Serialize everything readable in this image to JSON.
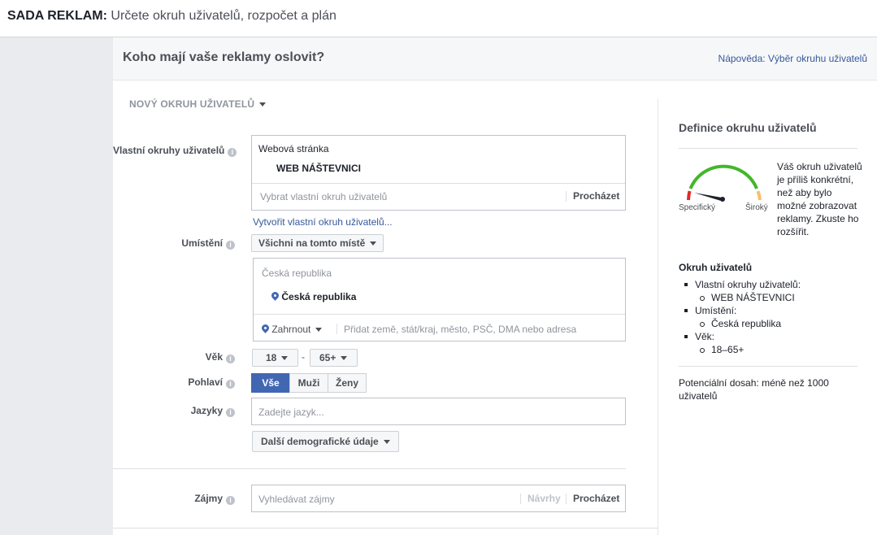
{
  "topbar": {
    "prefix": "SADA REKLAM:",
    "subtitle": "Určete okruh uživatelů, rozpočet a plán"
  },
  "section": {
    "title": "Koho mají vaše reklamy oslovit?",
    "help_link": "Nápověda: Výběr okruhu uživatelů"
  },
  "new_audience": "NOVÝ OKRUH UŽIVATELŮ",
  "custom_audiences": {
    "label": "Vlastní okruhy uživatelů",
    "group": "Webová stránka",
    "item": "WEB NÁŠTEVNICI",
    "placeholder": "Vybrat vlastní okruh uživatelů",
    "browse": "Procházet",
    "create_link": "Vytvořit vlastní okruh uživatelů..."
  },
  "location": {
    "label": "Umístění",
    "scope": "Všichni na tomto místě",
    "group": "Česká republika",
    "item": "Česká republika",
    "include": "Zahrnout",
    "placeholder": "Přidat země, stát/kraj, město, PSČ, DMA nebo adresa"
  },
  "age": {
    "label": "Věk",
    "min": "18",
    "dash": "-",
    "max": "65+"
  },
  "gender": {
    "label": "Pohlaví",
    "all": "Vše",
    "men": "Muži",
    "women": "Ženy"
  },
  "languages": {
    "label": "Jazyky",
    "placeholder": "Zadejte jazyk..."
  },
  "more_demographics": "Další demografické údaje",
  "interests": {
    "label": "Zájmy",
    "placeholder": "Vyhledávat zájmy",
    "suggestions": "Návrhy",
    "browse": "Procházet"
  },
  "right_panel": {
    "title": "Definice okruhu uživatelů",
    "gauge_specific": "Specifický",
    "gauge_broad": "Široký",
    "gauge_message": "Váš okruh uživatelů je příliš konkrétní, než aby bylo možné zobrazovat reklamy. Zkuste ho rozšířit.",
    "audience_heading": "Okruh uživatelů",
    "items": [
      {
        "label": "Vlastní okruhy uživatelů:",
        "sub": "WEB NÁŠTEVNICI"
      },
      {
        "label": "Umístění:",
        "sub": "Česká republika"
      },
      {
        "label": "Věk:",
        "sub": "18–65+"
      }
    ],
    "reach": "Potenciální dosah: méně než 1000 uživatelů"
  },
  "colors": {
    "accent": "#4267b2",
    "link": "#365899",
    "gauge_green": "#42b72a",
    "gauge_red": "#e02b27",
    "gauge_yellow": "#f7c06b"
  }
}
